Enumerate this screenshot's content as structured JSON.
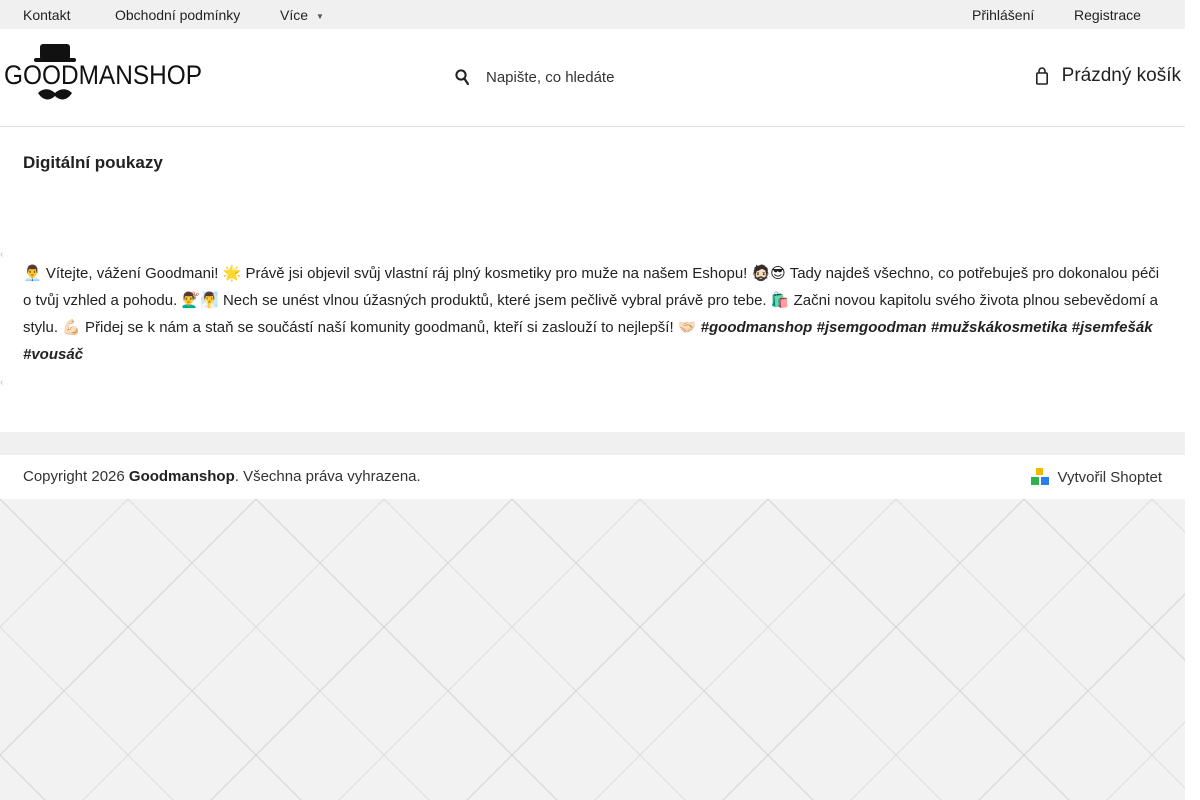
{
  "topbar": {
    "contact": "Kontakt",
    "terms": "Obchodní podmínky",
    "more": "Více",
    "login": "Přihlášení",
    "register": "Registrace"
  },
  "header": {
    "logo_text": "GOODMANSHOP",
    "search_placeholder": "Napište, co hledáte",
    "cart_label": "Prázdný košík"
  },
  "main": {
    "title": "Digitální poukazy",
    "intro_text": "👨‍💼 Vítejte, vážení Goodmani! 🌟 Právě jsi objevil svůj vlastní ráj plný kosmetiky pro muže na našem Eshopu! 🧔🏻😎 Tady najdeš všechno, co potřebuješ pro dokonalou péči o tvůj vzhled a pohodu. 💇‍♂️🧖‍♂️ Nech se unést vlnou úžasných produktů, které jsem pečlivě vybral právě pro tebe. 🛍️ Začni novou kapitolu svého života plnou sebevědomí a stylu. 💪🏻 Přidej se k nám a staň se součástí naší komunity goodmanů, kteří si zaslouží to nejlepší! 🤝🏻 ",
    "hashtags": [
      "#goodmanshop",
      "#jsemgoodman",
      "#mužskákosmetika",
      "#jsemfešák",
      "#vousáč"
    ]
  },
  "footer": {
    "copyright_prefix": "Copyright 2026 ",
    "brand": "Goodmanshop",
    "copyright_suffix": ". Všechna práva vyhrazena.",
    "shoptet": "Vytvořil Shoptet"
  },
  "colors": {
    "topbar_bg": "#f0f0f0",
    "text": "#222222",
    "pattern_bg": "#f2f2f2",
    "shoptet_yellow": "#f5b800",
    "shoptet_blue": "#2b7de9",
    "shoptet_green": "#2fb24c"
  }
}
